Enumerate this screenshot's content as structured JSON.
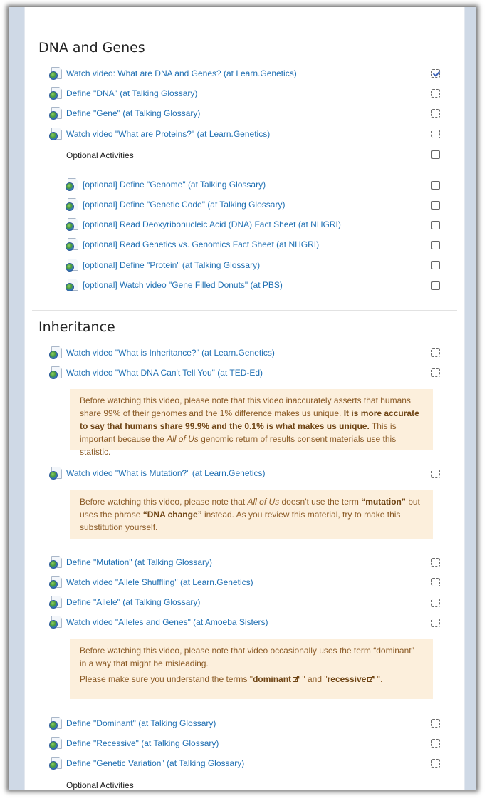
{
  "sections": [
    {
      "title": "DNA and Genes",
      "activities": [
        {
          "label": "Watch video: What are DNA and Genes? (at Learn.Genetics)",
          "completion": "checked"
        },
        {
          "label": "Define \"DNA\" (at Talking Glossary)",
          "completion": "dashed"
        },
        {
          "label": "Define \"Gene\" (at Talking Glossary)",
          "completion": "dashed"
        },
        {
          "label": "Watch video \"What are Proteins?\" (at Learn.Genetics)",
          "completion": "dashed"
        }
      ],
      "optional_label": "Optional Activities",
      "optional_activities": [
        {
          "label": "[optional] Define \"Genome\" (at Talking Glossary)",
          "completion": "solid"
        },
        {
          "label": "[optional] Define \"Genetic Code\" (at Talking Glossary)",
          "completion": "solid"
        },
        {
          "label": "[optional] Read Deoxyribonucleic Acid (DNA) Fact Sheet (at NHGRI)",
          "completion": "solid"
        },
        {
          "label": "[optional] Read Genetics vs. Genomics Fact Sheet (at NHGRI)",
          "completion": "solid"
        },
        {
          "label": "[optional] Define \"Protein\" (at Talking Glossary)",
          "completion": "solid"
        },
        {
          "label": "[optional] Watch video \"Gene Filled Donuts\" (at PBS)",
          "completion": "solid"
        }
      ]
    },
    {
      "title": "Inheritance",
      "activities": [
        {
          "label": "Watch video \"What is Inheritance?\" (at Learn.Genetics)",
          "completion": "dashed"
        },
        {
          "label": "Watch video \"What DNA Can't Tell You\" (at TED-Ed)",
          "completion": "dashed"
        },
        {
          "label": "Watch video \"What is Mutation?\" (at Learn.Genetics)",
          "completion": "dashed"
        },
        {
          "label": "Define \"Mutation\" (at Talking Glossary)",
          "completion": "dashed"
        },
        {
          "label": "Watch video \"Allele Shuffling\" (at Learn.Genetics)",
          "completion": "dashed"
        },
        {
          "label": "Define \"Allele\" (at Talking Glossary)",
          "completion": "dashed"
        },
        {
          "label": "Watch video \"Alleles and Genes\" (at Amoeba Sisters)",
          "completion": "dashed"
        },
        {
          "label": "Define \"Dominant\" (at Talking Glossary)",
          "completion": "dashed"
        },
        {
          "label": "Define \"Recessive\" (at Talking Glossary)",
          "completion": "dashed"
        },
        {
          "label": "Define \"Genetic Variation\" (at Talking Glossary)",
          "completion": "dashed"
        }
      ],
      "notes": {
        "ted": {
          "part1": "Before watching this video, please note that this video inaccurately asserts that humans share 99% of their genomes and the 1% difference makes us unique. ",
          "bold": "It is more accurate to say that humans share 99.9% and the 0.1% is what makes us unique.",
          "part2": " This is important because the ",
          "italic": "All of Us",
          "part3": " genomic return of results consent materials use this statistic."
        },
        "mutation": {
          "part1": "Before watching this video, please note that ",
          "italic": "All of Us",
          "part2": " doesn't use the term ",
          "bold1": "“mutation”",
          "part3": " but uses the phrase ",
          "bold2": "“DNA change”",
          "part4": " instead. As you review this material, try to make this substitution yourself."
        },
        "alleles": {
          "line1": "Before watching this video, please note that video occasionally uses the term “dominant” in a way that might be misleading.",
          "line2_a": "Please make sure you understand the terms \"",
          "term1": "dominant",
          "line2_b": " \" and \"",
          "term2": "recessive",
          "line2_c": " \"."
        }
      },
      "optional_label": "Optional Activities"
    }
  ],
  "icons": {
    "activity": "url-globe-icon",
    "external": "external-link-icon"
  },
  "colors": {
    "link": "#1f6fb2",
    "note_bg": "#fcefdc",
    "note_text": "#8a5a25",
    "frame_bg": "#cfd9e6"
  }
}
